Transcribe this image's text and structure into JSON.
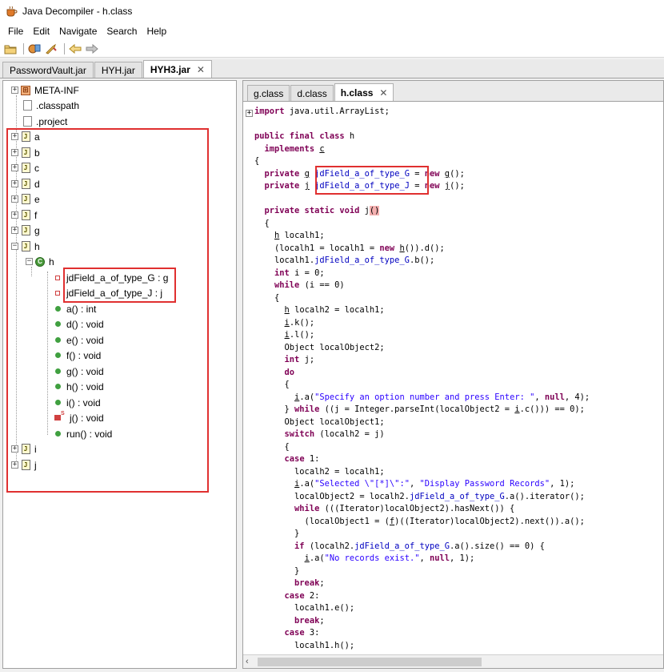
{
  "window": {
    "title": "Java Decompiler - h.class"
  },
  "menu": [
    "File",
    "Edit",
    "Navigate",
    "Search",
    "Help"
  ],
  "toolbar": [
    "open-file-icon",
    "open-type-icon",
    "search-icon",
    "back-icon",
    "forward-icon"
  ],
  "jar_tabs": [
    {
      "label": "PasswordVault.jar",
      "active": false
    },
    {
      "label": "HYH.jar",
      "active": false
    },
    {
      "label": "HYH3.jar",
      "active": true
    }
  ],
  "tree": {
    "meta_inf": "META-INF",
    "classpath": ".classpath",
    "project": ".project",
    "packages": [
      "a",
      "b",
      "c",
      "d",
      "e",
      "f",
      "g",
      "h"
    ],
    "class_h": "h",
    "fields": [
      "jdField_a_of_type_G : g",
      "jdField_a_of_type_J : j"
    ],
    "methods": [
      "a() : int",
      "d() : void",
      "e() : void",
      "f() : void",
      "g() : void",
      "h() : void",
      "i() : void",
      "j() : void",
      "run() : void"
    ],
    "packages_after": [
      "i",
      "j"
    ]
  },
  "class_tabs": [
    {
      "label": "g.class",
      "active": false
    },
    {
      "label": "d.class",
      "active": false
    },
    {
      "label": "h.class",
      "active": true
    }
  ],
  "code": {
    "import": "import java.util.ArrayList;",
    "class_decl_kw": "public final class",
    "class_name": "h",
    "implements_kw": "implements",
    "implements_type": "c",
    "open_brace": "{",
    "field1_type": "g",
    "field1_name": "jdField_a_of_type_G",
    "field1_init_type": "g",
    "field2_type": "j",
    "field2_name": "jdField_a_of_type_J",
    "field2_init_type": "j",
    "method_name": "j",
    "strings": {
      "specify": "\"Specify an option number and press Enter: \"",
      "selected": "\"Selected \\\"[*]\\\":\"",
      "display": "\"Display Password Records\"",
      "norecords": "\"No records exist.\""
    }
  }
}
